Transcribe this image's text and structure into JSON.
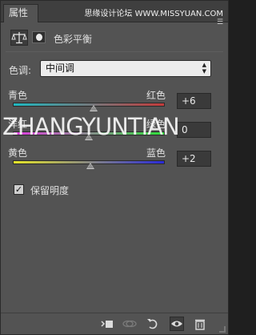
{
  "panel": {
    "tab_label": "属性",
    "menu_icon": "panel-menu-icon"
  },
  "watermark": {
    "text": "思缘设计论坛 WWW.MISSYUAN.COM"
  },
  "header": {
    "title": "色彩平衡",
    "adjustment_icon": "balance-scale-icon",
    "mask_icon": "layer-mask-icon"
  },
  "tone": {
    "label": "色调:",
    "selected": "中间调"
  },
  "sliders": [
    {
      "left_label": "青色",
      "right_label": "红色",
      "value": "+6",
      "numeric": 6,
      "gradient": [
        "#1fb8c0",
        "#c33b3b"
      ]
    },
    {
      "left_label": "洋红",
      "right_label": "绿色",
      "value": "0",
      "numeric": 0,
      "gradient": [
        "#e23ce2",
        "#2fe03a"
      ]
    },
    {
      "left_label": "黄色",
      "right_label": "蓝色",
      "value": "+2",
      "numeric": 2,
      "gradient": [
        "#e6e62a",
        "#2a2ad8"
      ]
    }
  ],
  "overlay_text": "ZHANGYUNTIAN",
  "preserve": {
    "label": "保留明度",
    "checked": true
  },
  "footer": {
    "icons": [
      "clip-to-layer-icon",
      "view-previous-icon",
      "reset-icon",
      "visibility-eye-icon",
      "delete-trash-icon"
    ]
  }
}
